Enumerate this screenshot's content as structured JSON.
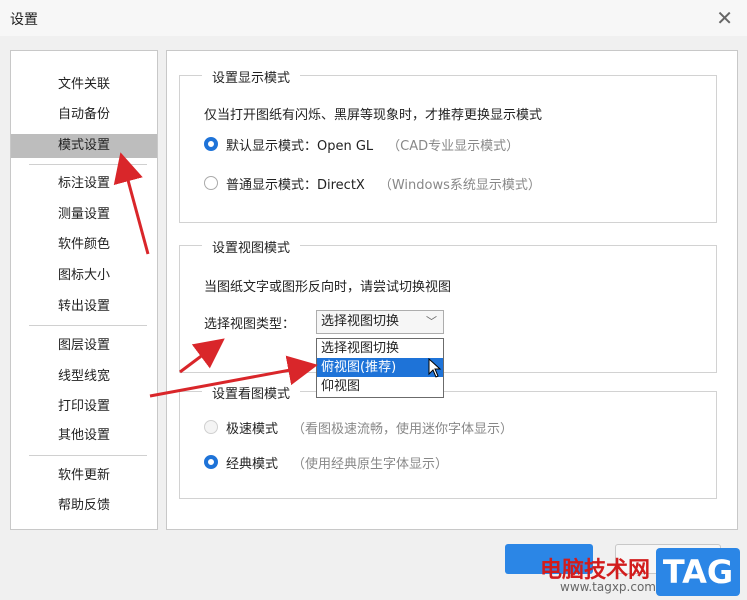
{
  "window": {
    "title": "设置"
  },
  "sidebar": {
    "items": [
      {
        "label": "文件关联"
      },
      {
        "label": "自动备份"
      },
      {
        "label": "模式设置"
      },
      {
        "label": "标注设置"
      },
      {
        "label": "测量设置"
      },
      {
        "label": "软件颜色"
      },
      {
        "label": "图标大小"
      },
      {
        "label": "转出设置"
      },
      {
        "label": "图层设置"
      },
      {
        "label": "线型线宽"
      },
      {
        "label": "打印设置"
      },
      {
        "label": "其他设置"
      },
      {
        "label": "软件更新"
      },
      {
        "label": "帮助反馈"
      }
    ]
  },
  "display_mode": {
    "title": "设置显示模式",
    "description": "仅当打开图纸有闪烁、黑屏等现象时，才推荐更换显示模式",
    "options": [
      {
        "label": "默认显示模式：Open GL",
        "hint": "（CAD专业显示模式）",
        "checked": true
      },
      {
        "label": "普通显示模式：DirectX",
        "hint": "（Windows系统显示模式）",
        "checked": false
      }
    ]
  },
  "view_mode": {
    "title": "设置视图模式",
    "description": "当图纸文字或图形反向时，请尝试切换视图",
    "select_label": "选择视图类型：",
    "selected": "选择视图切换",
    "options": [
      "选择视图切换",
      "俯视图(推荐)",
      "仰视图"
    ],
    "highlighted_option": "俯视图(推荐)"
  },
  "viewing_mode": {
    "title": "设置看图模式",
    "options": [
      {
        "label": "极速模式",
        "hint": "（看图极速流畅，使用迷你字体显示）",
        "checked": false,
        "disabled": true
      },
      {
        "label": "经典模式",
        "hint": "（使用经典原生字体显示）",
        "checked": true,
        "disabled": false
      }
    ]
  },
  "watermark": {
    "text": "电脑技术网",
    "url": "www.tagxp.com",
    "badge": "TAG"
  },
  "colors": {
    "accent": "#1e73d8",
    "arrow": "#d9262a",
    "selected_sidebar": "#bdbdbd"
  }
}
